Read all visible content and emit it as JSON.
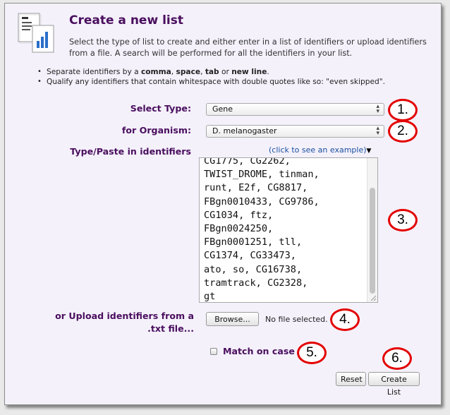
{
  "header": {
    "title": "Create a new list",
    "intro": "Select the type of list to create and either enter in a list of identifiers or upload identifiers from a file. A search will be performed for all the identifiers in your list."
  },
  "tips": {
    "tip1": {
      "prefix": "Separate identifiers by a ",
      "k1": "comma",
      "sep1": ", ",
      "k2": "space",
      "sep2": ", ",
      "k3": "tab",
      "sep3": " or ",
      "k4": "new line",
      "suffix": "."
    },
    "tip2": "Qualify any identifiers that contain whitespace with double quotes like so: \"even skipped\"."
  },
  "form": {
    "type_label": "Select Type:",
    "type_value": "Gene",
    "organism_label": "for Organism:",
    "organism_value": "D. melanogaster",
    "paste_label": "Type/Paste in identifiers",
    "example_link": "(click to see an example)",
    "identifiers_lines": [
      "CG1775, CG2262,",
      "TWIST_DROME, tinman,",
      "runt, E2f, CG8817,",
      "FBgn0010433, CG9786,",
      "CG1034, ftz,",
      "FBgn0024250,",
      "FBgn0001251, tll,",
      "CG1374, CG33473,",
      "ato, so, CG16738,",
      "tramtrack,  CG2328,",
      "gt"
    ],
    "upload_label_line1": "or Upload identifiers from a",
    "upload_label_line2": ".txt file...",
    "browse_label": "Browse...",
    "file_status": "No file selected.",
    "match_case_label": "Match on case",
    "reset_label": "Reset",
    "create_label": "Create List"
  },
  "callouts": [
    "1.",
    "2.",
    "3.",
    "4.",
    "5.",
    "6."
  ],
  "colors": {
    "heading": "#4a0e5e",
    "panel_bg": "#f4f1fb",
    "link": "#1a4f9e",
    "callout_ring": "#e30000"
  },
  "icons": {
    "header_icon": "document-list-chart-icon",
    "select_arrows": "updown-arrows-icon",
    "example_toggle": "triangle-down-icon"
  }
}
